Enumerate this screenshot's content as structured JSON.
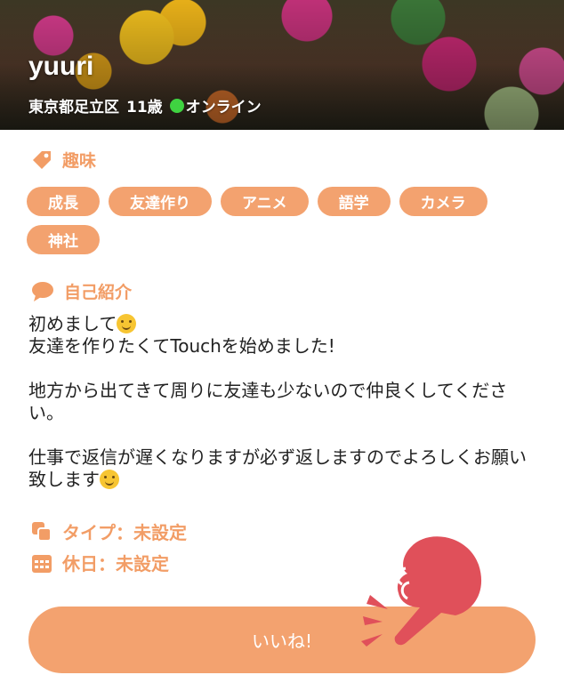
{
  "profile": {
    "name": "yuuri",
    "location": "東京都足立区",
    "age": "11歳",
    "status": "オンライン"
  },
  "hobbies": {
    "title": "趣味",
    "tags": [
      "成長",
      "友達作り",
      "アニメ",
      "語学",
      "カメラ",
      "神社"
    ]
  },
  "intro": {
    "title": "自己紹介",
    "line1": "初めまして",
    "text": "友達を作りたくてTouchを始めました!\n\n地方から出てきて周りに友達も少ないので仲良くしてください。\n\n仕事で返信が遅くなりますが必ず返しますのでよろしくお願い致します"
  },
  "type": {
    "label": "タイプ：未設定"
  },
  "holiday": {
    "label": "休日：未設定"
  },
  "like_button": {
    "label": "いいね!"
  },
  "colors": {
    "accent": "#f3a26f",
    "accent_text": "#f29d66",
    "online": "#3fd341",
    "hand": "#e0505a"
  },
  "icons": [
    "tag-icon",
    "chat-bubble-icon",
    "type-icon",
    "calendar-icon",
    "tap-hand-icon"
  ]
}
